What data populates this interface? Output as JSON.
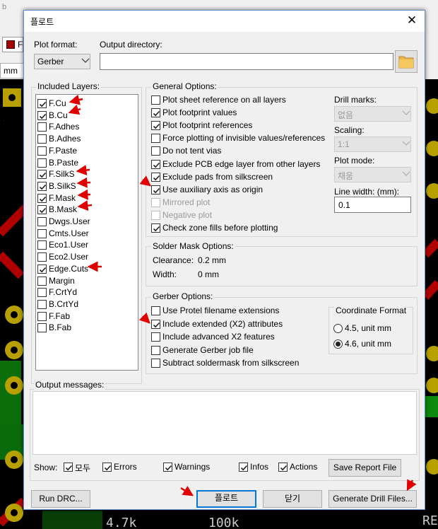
{
  "background": {
    "toolbar_letter": "b",
    "layer_swatch_letter": "F",
    "unit_label": "mm",
    "silk_texts": [
      "4.7k",
      "100k",
      "RE"
    ]
  },
  "dialog": {
    "title": "플로트",
    "close_glyph": "✕",
    "plot_format_label": "Plot format:",
    "plot_format_value": "Gerber",
    "output_dir_label": "Output directory:",
    "output_dir_value": "",
    "included_layers_title": "Included Layers:",
    "layers": [
      {
        "name": "F.Cu",
        "checked": true
      },
      {
        "name": "B.Cu",
        "checked": true
      },
      {
        "name": "F.Adhes",
        "checked": false
      },
      {
        "name": "B.Adhes",
        "checked": false
      },
      {
        "name": "F.Paste",
        "checked": false
      },
      {
        "name": "B.Paste",
        "checked": false
      },
      {
        "name": "F.SilkS",
        "checked": true
      },
      {
        "name": "B.SilkS",
        "checked": true
      },
      {
        "name": "F.Mask",
        "checked": true
      },
      {
        "name": "B.Mask",
        "checked": true
      },
      {
        "name": "Dwgs.User",
        "checked": false
      },
      {
        "name": "Cmts.User",
        "checked": false
      },
      {
        "name": "Eco1.User",
        "checked": false
      },
      {
        "name": "Eco2.User",
        "checked": false
      },
      {
        "name": "Edge.Cuts",
        "checked": true
      },
      {
        "name": "Margin",
        "checked": false
      },
      {
        "name": "F.CrtYd",
        "checked": false
      },
      {
        "name": "B.CrtYd",
        "checked": false
      },
      {
        "name": "F.Fab",
        "checked": false
      },
      {
        "name": "B.Fab",
        "checked": false
      }
    ],
    "general_title": "General Options:",
    "general_options": [
      {
        "label": "Plot sheet reference on all layers",
        "checked": false,
        "enabled": true
      },
      {
        "label": "Plot footprint values",
        "checked": true,
        "enabled": true
      },
      {
        "label": "Plot footprint references",
        "checked": true,
        "enabled": true
      },
      {
        "label": "Force plotting of invisible values/references",
        "checked": false,
        "enabled": true
      },
      {
        "label": "Do not tent vias",
        "checked": false,
        "enabled": true
      },
      {
        "label": "Exclude PCB edge layer from other layers",
        "checked": true,
        "enabled": true
      },
      {
        "label": "Exclude pads from silkscreen",
        "checked": true,
        "enabled": true
      },
      {
        "label": "Use auxiliary axis as origin",
        "checked": true,
        "enabled": true
      },
      {
        "label": "Mirrored plot",
        "checked": false,
        "enabled": false
      },
      {
        "label": "Negative plot",
        "checked": false,
        "enabled": false
      },
      {
        "label": "Check zone fills before plotting",
        "checked": true,
        "enabled": true
      }
    ],
    "drill_marks_label": "Drill marks:",
    "drill_marks_value": "없음",
    "scaling_label": "Scaling:",
    "scaling_value": "1:1",
    "plot_mode_label": "Plot mode:",
    "plot_mode_value": "채움",
    "line_width_label": "Line width: (mm):",
    "line_width_value": "0.1",
    "solder_title": "Solder Mask Options:",
    "clearance_label": "Clearance:",
    "clearance_value": "0.2 mm",
    "width_label": "Width:",
    "width_value": "0 mm",
    "gerber_title": "Gerber Options:",
    "gerber_options": [
      {
        "label": "Use Protel filename extensions",
        "checked": false
      },
      {
        "label": "Include extended (X2) attributes",
        "checked": true
      },
      {
        "label": "Include advanced X2 features",
        "checked": false
      },
      {
        "label": "Generate Gerber job file",
        "checked": false
      },
      {
        "label": "Subtract soldermask from silkscreen",
        "checked": false
      }
    ],
    "coord_title": "Coordinate Format",
    "coord_options": [
      {
        "label": "4.5, unit mm",
        "selected": false
      },
      {
        "label": "4.6, unit mm",
        "selected": true
      }
    ],
    "output_messages_title": "Output messages:",
    "show_label": "Show:",
    "filters": [
      {
        "label": "모두",
        "checked": true
      },
      {
        "label": "Errors",
        "checked": true
      },
      {
        "label": "Warnings",
        "checked": true
      },
      {
        "label": "Infos",
        "checked": true
      },
      {
        "label": "Actions",
        "checked": true
      }
    ],
    "save_report_label": "Save Report File",
    "run_drc_label": "Run DRC...",
    "plot_button_label": "플로트",
    "close_button_label": "닫기",
    "drill_button_label": "Generate Drill Files..."
  }
}
